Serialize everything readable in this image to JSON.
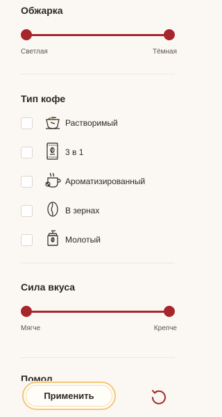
{
  "roast": {
    "title": "Обжарка",
    "min_label": "Светлая",
    "max_label": "Тёмная",
    "range": [
      0,
      1
    ]
  },
  "coffee_type": {
    "title": "Тип кофе",
    "options": [
      {
        "label": "Растворимый",
        "icon": "instant-coffee-icon",
        "checked": false
      },
      {
        "label": "3 в 1",
        "icon": "sachet-icon",
        "checked": false
      },
      {
        "label": "Ароматизированный",
        "icon": "flavored-coffee-icon",
        "checked": false
      },
      {
        "label": "В зернах",
        "icon": "coffee-bean-icon",
        "checked": false
      },
      {
        "label": "Молотый",
        "icon": "coffee-grinder-icon",
        "checked": false
      }
    ]
  },
  "strength": {
    "title": "Сила вкуса",
    "min_label": "Мягче",
    "max_label": "Крепче",
    "range": [
      0,
      1
    ]
  },
  "next_section": {
    "title": "Помол"
  },
  "actions": {
    "apply_label": "Применить",
    "reset_icon": "reset-icon"
  },
  "colors": {
    "accent": "#a6262b",
    "button_border": "#f3c778",
    "background": "#fbf8f3"
  }
}
